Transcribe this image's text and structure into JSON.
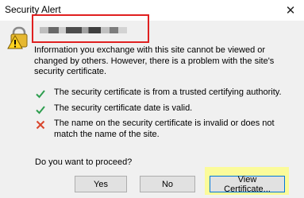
{
  "window": {
    "title": "Security Alert",
    "close_glyph": "✕"
  },
  "message": {
    "info": "Information you exchange with this site cannot be viewed or changed by others. However, there is a problem with the site's security certificate."
  },
  "checks": [
    {
      "status": "ok",
      "icon": "green-check-icon",
      "text": "The security certificate is from a trusted certifying authority."
    },
    {
      "status": "ok",
      "icon": "green-check-icon",
      "text": "The security certificate date is valid."
    },
    {
      "status": "error",
      "icon": "red-x-icon",
      "text": "The name on the security certificate is invalid or does not match the name of the site."
    }
  ],
  "prompt": "Do you want to proceed?",
  "buttons": {
    "yes": "Yes",
    "no": "No",
    "view_certificate": "View Certificate..."
  },
  "colors": {
    "ok": "#2e9e4f",
    "error": "#d9452b",
    "annotation_box": "#e02020",
    "annotation_highlight": "#fbfb9a"
  }
}
